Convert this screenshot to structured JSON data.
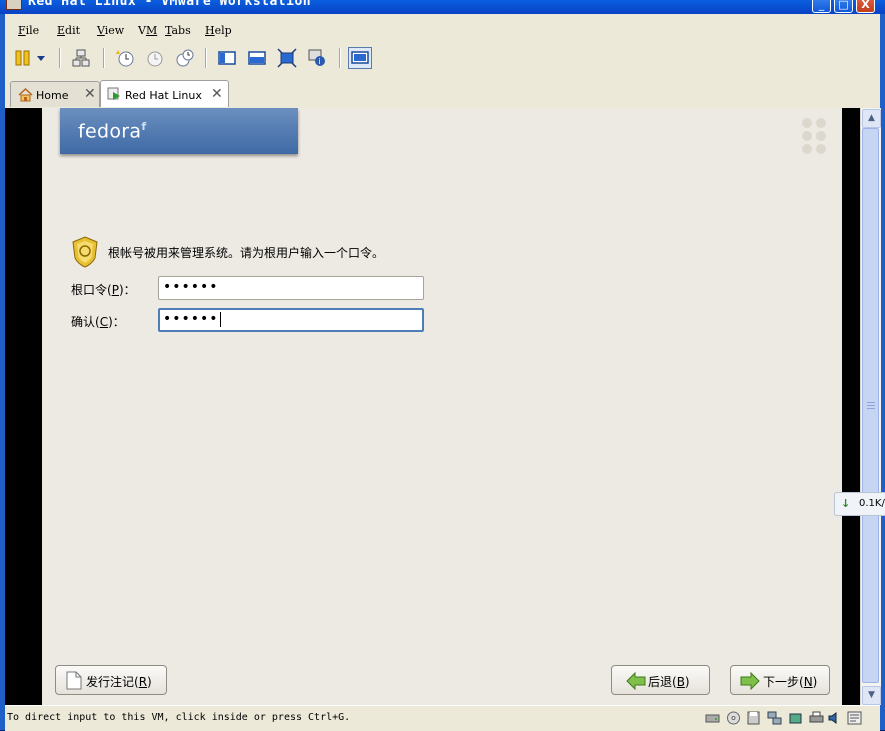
{
  "window": {
    "title": "Red Hat Linux - VMware Workstation",
    "controls": {
      "minimize": "_",
      "maximize": "□",
      "close": "X"
    }
  },
  "menu": [
    {
      "label": "File",
      "hotkey": "F"
    },
    {
      "label": "Edit",
      "hotkey": "E"
    },
    {
      "label": "View",
      "hotkey": "V"
    },
    {
      "label": "VM",
      "hotkey": "M"
    },
    {
      "label": "Tabs",
      "hotkey": "T"
    },
    {
      "label": "Help",
      "hotkey": "H"
    }
  ],
  "toolbar": {
    "icons": [
      "pause-icon",
      "dropdown-icon",
      "network-icon",
      "snapshot-take-icon",
      "snapshot-revert-icon",
      "snapshot-manager-icon",
      "sidebar-view-icon",
      "quick-switch-icon",
      "full-screen-icon",
      "summary-icon",
      "console-view-icon"
    ]
  },
  "tabs": [
    {
      "label": "Home",
      "icon": "home-icon",
      "close": "✕",
      "active": false
    },
    {
      "label": "Red Hat Linux",
      "icon": "vm-icon",
      "close": "✕",
      "active": true
    }
  ],
  "installer": {
    "brand": "fedora",
    "brand_mark": "f",
    "intro_text": "根帐号被用来管理系统。请为根用户输入一个口令。",
    "root_password": {
      "label_pre": "根口令(",
      "hotkey": "P",
      "label_post": ")：",
      "value": "••••••"
    },
    "confirm_password": {
      "label_pre": "确认(",
      "hotkey": "C",
      "label_post": ")：",
      "value": "••••••"
    },
    "release_notes": {
      "label_pre": "发行注记(",
      "hotkey": "R",
      "label_post": ")"
    },
    "back": {
      "label_pre": "后退(",
      "hotkey": "B",
      "label_post": ")"
    },
    "next": {
      "label_pre": "下一步(",
      "hotkey": "N",
      "label_post": ")"
    }
  },
  "net_speed": {
    "arrow": "↓",
    "text": "0.1K/"
  },
  "statusbar": {
    "message": "To direct input to this VM, click inside or press Ctrl+G.",
    "icons": [
      "hard-disk-icon",
      "cdrom-icon",
      "floppy-icon",
      "network-adapter-icon",
      "usb-icon",
      "printer-icon",
      "sound-icon",
      "message-log-icon"
    ]
  },
  "colors": {
    "titlebar": "#0842c4",
    "chrome": "#ece9d8",
    "installer_bg": "#ede9e3",
    "banner": "#3f6aa5",
    "focus_border": "#4d7db5"
  }
}
